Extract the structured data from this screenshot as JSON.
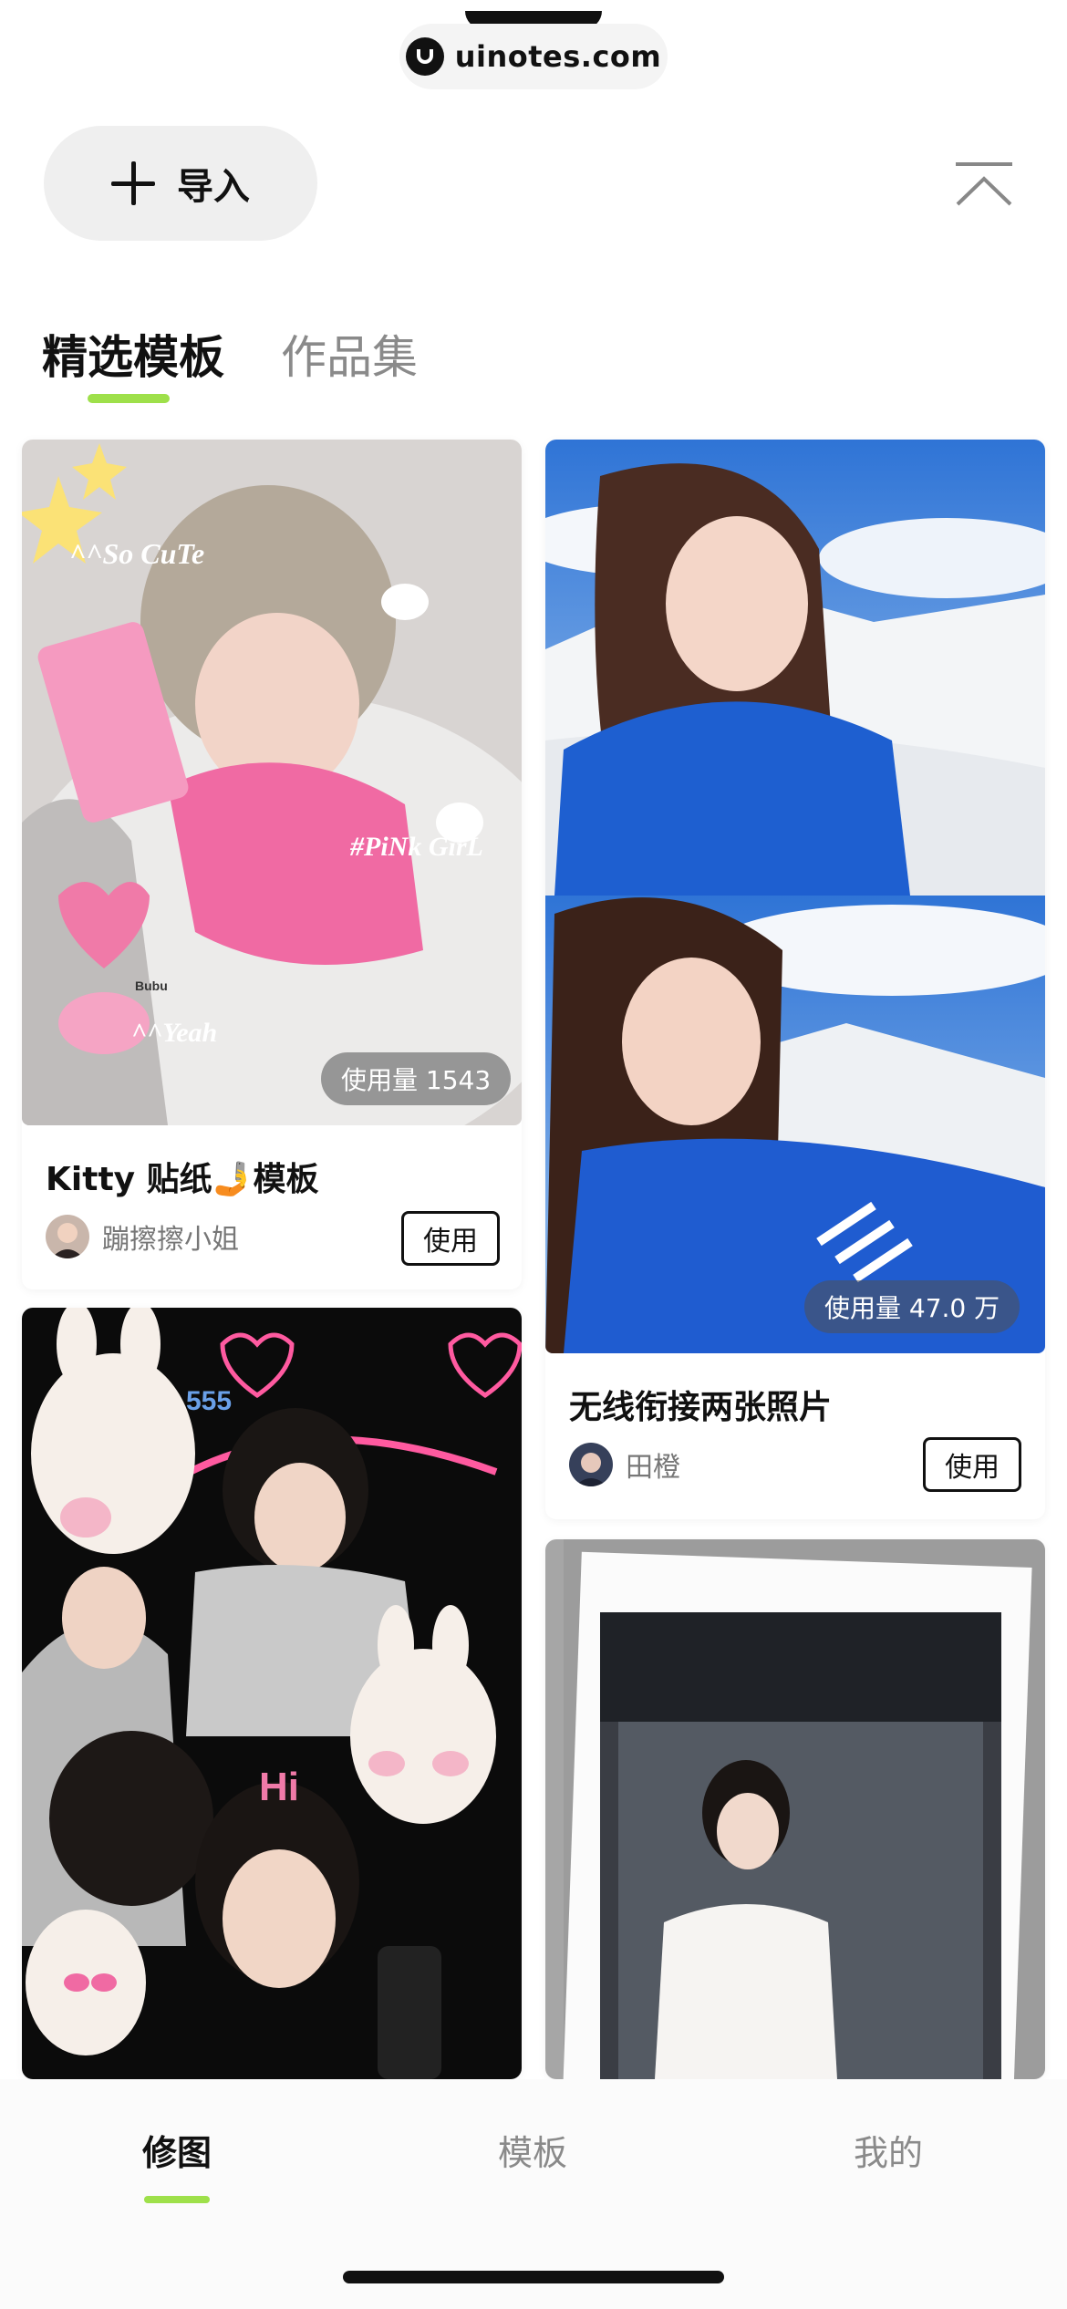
{
  "watermark": {
    "text": "uinotes.com"
  },
  "header": {
    "import_label": "导入"
  },
  "tabs": [
    {
      "label": "精选模板",
      "active": true
    },
    {
      "label": "作品集",
      "active": false
    }
  ],
  "cards": [
    {
      "sticker_texts": [
        "^^So CuTe",
        "#PiNk GirL",
        "^^Yeah",
        "Bubu"
      ],
      "usage": "使用量 1543",
      "title": "Kitty 贴纸🤳模板",
      "author": "蹦擦擦小姐",
      "use_label": "使用"
    },
    {
      "usage": "使用量 47.0 万",
      "title": "无线衔接两张照片",
      "author": "田橙",
      "use_label": "使用"
    },
    {
      "sticker_texts": [
        "555",
        "Hi"
      ]
    },
    {}
  ],
  "bottom_nav": [
    {
      "label": "修图",
      "active": true
    },
    {
      "label": "模板",
      "active": false
    },
    {
      "label": "我的",
      "active": false
    }
  ],
  "colors": {
    "accent": "#9ee04a",
    "text": "#111111",
    "muted": "#8a8a8a"
  }
}
